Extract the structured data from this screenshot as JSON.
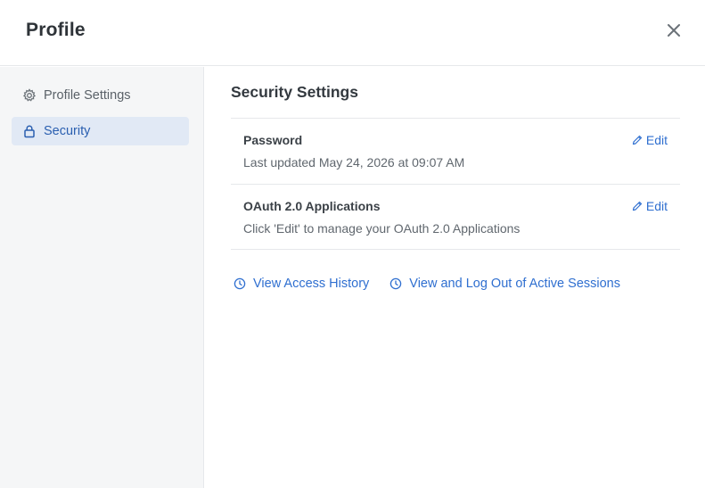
{
  "header": {
    "title": "Profile",
    "close_icon": "close-icon"
  },
  "sidebar": {
    "items": [
      {
        "label": "Profile Settings",
        "icon": "gear-icon",
        "active": false
      },
      {
        "label": "Security",
        "icon": "lock-icon",
        "active": true
      }
    ]
  },
  "main": {
    "section_title": "Security Settings",
    "rows": [
      {
        "name": "Password",
        "description": "Last updated May 24, 2026 at 09:07 AM",
        "action": "Edit",
        "action_icon": "pencil-icon"
      },
      {
        "name": "OAuth 2.0 Applications",
        "description": "Click 'Edit' to manage your OAuth 2.0 Applications",
        "action": "Edit",
        "action_icon": "pencil-icon"
      }
    ],
    "links": [
      {
        "label": "View Access History",
        "icon": "clock-icon"
      },
      {
        "label": "View and Log Out of Active Sessions",
        "icon": "clock-icon"
      }
    ]
  },
  "colors": {
    "accent": "#2f6fd0",
    "active_bg": "#e1e9f5",
    "sidebar_bg": "#f5f6f7",
    "border": "#e6e8eb"
  }
}
